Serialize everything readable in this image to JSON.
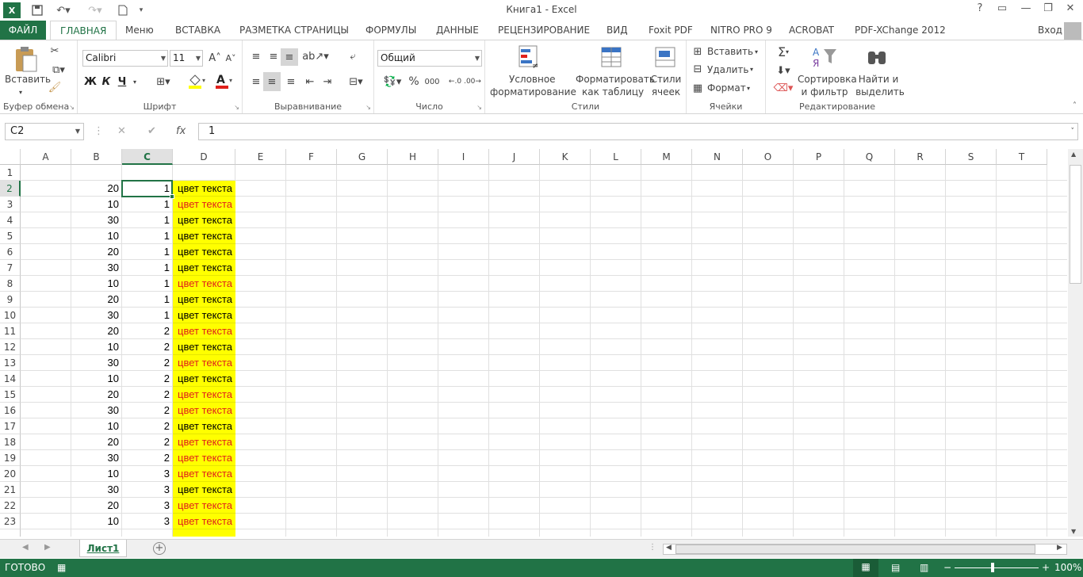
{
  "app": {
    "title": "Книга1 - Excel",
    "accent": "#217346",
    "icons": [
      "excel-logo-icon",
      "save-icon",
      "undo-icon",
      "redo-icon",
      "new-file-icon",
      "customize-icon",
      "help-icon",
      "ribbon-display-icon",
      "minimize-icon",
      "restore-icon",
      "close-icon"
    ]
  },
  "tabs": {
    "file": "ФАЙЛ",
    "home": "ГЛАВНАЯ",
    "menu": "Меню",
    "insert": "ВСТАВКА",
    "layout": "РАЗМЕТКА СТРАНИЦЫ",
    "formulas": "ФОРМУЛЫ",
    "data": "ДАННЫЕ",
    "review": "РЕЦЕНЗИРОВАНИЕ",
    "view": "ВИД",
    "foxit": "Foxit PDF",
    "nitro": "NITRO PRO 9",
    "acrobat": "ACROBAT",
    "pdfx": "PDF-XChange 2012",
    "signin": "Вход"
  },
  "ribbon": {
    "clipboard": {
      "label": "Буфер обмена",
      "paste": "Вставить"
    },
    "font": {
      "label": "Шрифт",
      "name": "Calibri",
      "size": "11",
      "bold": "Ж",
      "italic": "К",
      "underline": "Ч"
    },
    "alignment": {
      "label": "Выравнивание"
    },
    "number": {
      "label": "Число",
      "format": "Общий",
      "percent": "%",
      "thousands": "000"
    },
    "styles": {
      "label": "Стили",
      "conditional_1": "Условное",
      "conditional_2": "форматирование",
      "table_1": "Форматировать",
      "table_2": "как таблицу",
      "cell_1": "Стили",
      "cell_2": "ячеек"
    },
    "cells": {
      "label": "Ячейки",
      "insert": "Вставить",
      "delete": "Удалить",
      "format": "Формат"
    },
    "editing": {
      "label": "Редактирование",
      "sort_1": "Сортировка",
      "sort_2": "и фильтр",
      "find_1": "Найти и",
      "find_2": "выделить",
      "sum": "Σ"
    }
  },
  "formula_bar": {
    "name_box": "C2",
    "fx": "fx",
    "value": "1"
  },
  "columns": [
    "A",
    "B",
    "C",
    "D",
    "E",
    "F",
    "G",
    "H",
    "I",
    "J",
    "K",
    "L",
    "M",
    "N",
    "O",
    "P",
    "Q",
    "R",
    "S",
    "T"
  ],
  "rows": [
    {
      "n": "1",
      "b": "",
      "c": "",
      "d": "",
      "red": false
    },
    {
      "n": "2",
      "b": "20",
      "c": "1",
      "d": "цвет текста",
      "red": false
    },
    {
      "n": "3",
      "b": "10",
      "c": "1",
      "d": "цвет текста",
      "red": true
    },
    {
      "n": "4",
      "b": "30",
      "c": "1",
      "d": "цвет текста",
      "red": false
    },
    {
      "n": "5",
      "b": "10",
      "c": "1",
      "d": "цвет текста",
      "red": false
    },
    {
      "n": "6",
      "b": "20",
      "c": "1",
      "d": "цвет текста",
      "red": false
    },
    {
      "n": "7",
      "b": "30",
      "c": "1",
      "d": "цвет текста",
      "red": false
    },
    {
      "n": "8",
      "b": "10",
      "c": "1",
      "d": "цвет текста",
      "red": true
    },
    {
      "n": "9",
      "b": "20",
      "c": "1",
      "d": "цвет текста",
      "red": false
    },
    {
      "n": "10",
      "b": "30",
      "c": "1",
      "d": "цвет текста",
      "red": false
    },
    {
      "n": "11",
      "b": "20",
      "c": "2",
      "d": "цвет текста",
      "red": true
    },
    {
      "n": "12",
      "b": "10",
      "c": "2",
      "d": "цвет текста",
      "red": false
    },
    {
      "n": "13",
      "b": "30",
      "c": "2",
      "d": "цвет текста",
      "red": true
    },
    {
      "n": "14",
      "b": "10",
      "c": "2",
      "d": "цвет текста",
      "red": false
    },
    {
      "n": "15",
      "b": "20",
      "c": "2",
      "d": "цвет текста",
      "red": true
    },
    {
      "n": "16",
      "b": "30",
      "c": "2",
      "d": "цвет текста",
      "red": true
    },
    {
      "n": "17",
      "b": "10",
      "c": "2",
      "d": "цвет текста",
      "red": false
    },
    {
      "n": "18",
      "b": "20",
      "c": "2",
      "d": "цвет текста",
      "red": true
    },
    {
      "n": "19",
      "b": "30",
      "c": "2",
      "d": "цвет текста",
      "red": true
    },
    {
      "n": "20",
      "b": "10",
      "c": "3",
      "d": "цвет текста",
      "red": true
    },
    {
      "n": "21",
      "b": "30",
      "c": "3",
      "d": "цвет текста",
      "red": false
    },
    {
      "n": "22",
      "b": "20",
      "c": "3",
      "d": "цвет текста",
      "red": true
    },
    {
      "n": "23",
      "b": "10",
      "c": "3",
      "d": "цвет текста",
      "red": true
    }
  ],
  "colors": {
    "red_text": "#e0201b",
    "highlight": "#ffff00"
  },
  "sheets": [
    "Лист1"
  ],
  "status": {
    "ready": "ГОТОВО",
    "zoom": "100%"
  }
}
